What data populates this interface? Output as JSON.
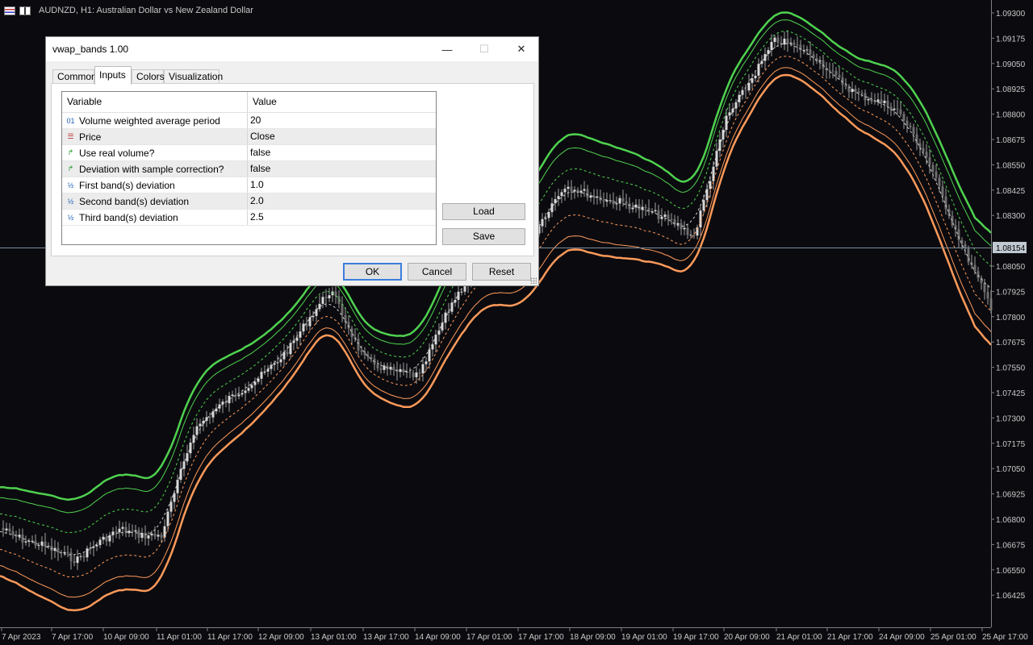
{
  "chart": {
    "title": "AUDNZD, H1:  Australian Dollar vs New Zealand Dollar",
    "current_price": "1.08154",
    "price_labels": [
      "1.09300",
      "1.09175",
      "1.09050",
      "1.08925",
      "1.08800",
      "1.08675",
      "1.08550",
      "1.08425",
      "1.08300",
      "1.08050",
      "1.07925",
      "1.07800",
      "1.07675",
      "1.07550",
      "1.07425",
      "1.07300",
      "1.07175",
      "1.07050",
      "1.06925",
      "1.06800",
      "1.06675",
      "1.06550",
      "1.06425"
    ],
    "time_labels": [
      "7 Apr 2023",
      "7 Apr 17:00",
      "10 Apr 09:00",
      "11 Apr 01:00",
      "11 Apr 17:00",
      "12 Apr 09:00",
      "13 Apr 01:00",
      "13 Apr 17:00",
      "14 Apr 09:00",
      "17 Apr 01:00",
      "17 Apr 17:00",
      "18 Apr 09:00",
      "19 Apr 01:00",
      "19 Apr 17:00",
      "20 Apr 09:00",
      "21 Apr 01:00",
      "21 Apr 17:00",
      "24 Apr 09:00",
      "25 Apr 01:00",
      "25 Apr 17:00"
    ],
    "colors": {
      "background": "#0b0b0f",
      "upper_band": "#4fd24f",
      "lower_band": "#ff9a5a",
      "vwap": "#cfcfcf",
      "candle": "#a0a0a0"
    }
  },
  "dialog": {
    "title": "vwap_bands 1.00",
    "tabs": [
      {
        "label": "Common"
      },
      {
        "label": "Inputs",
        "active": true
      },
      {
        "label": "Colors"
      },
      {
        "label": "Visualization"
      }
    ],
    "table": {
      "headers": {
        "variable": "Variable",
        "value": "Value"
      },
      "rows": [
        {
          "icon": "int-icon",
          "variable": "Volume weighted average period",
          "value": "20"
        },
        {
          "icon": "list-icon",
          "variable": "Price",
          "value": "Close"
        },
        {
          "icon": "bool-icon",
          "variable": "Use real volume?",
          "value": "false"
        },
        {
          "icon": "bool-icon",
          "variable": "Deviation with sample correction?",
          "value": "false"
        },
        {
          "icon": "double-icon",
          "variable": "First band(s) deviation",
          "value": "1.0"
        },
        {
          "icon": "double-icon",
          "variable": "Second band(s) deviation",
          "value": "2.0"
        },
        {
          "icon": "double-icon",
          "variable": "Third band(s) deviation",
          "value": "2.5"
        }
      ]
    },
    "buttons": {
      "load": "Load",
      "save": "Save",
      "ok": "OK",
      "cancel": "Cancel",
      "reset": "Reset"
    },
    "window_controls": {
      "minimize": "—",
      "maximize": "☐",
      "close": "✕"
    }
  }
}
